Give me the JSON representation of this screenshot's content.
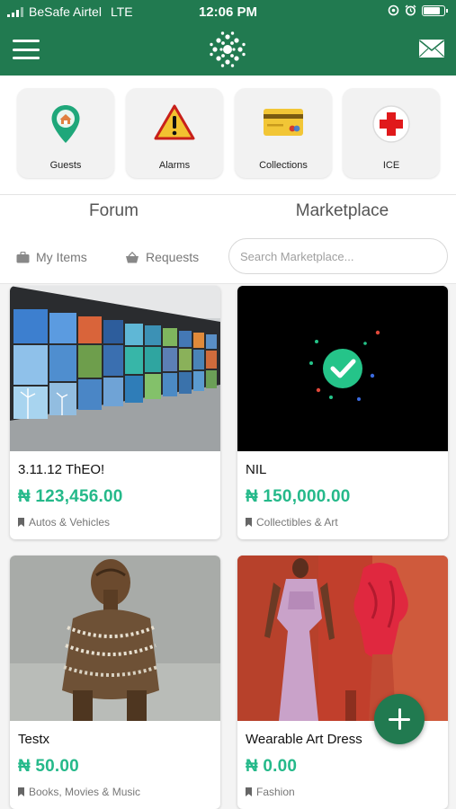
{
  "status_bar": {
    "carrier": "BeSafe Airtel",
    "network": "LTE",
    "time": "12:06 PM",
    "battery_level": 0.85
  },
  "header": {
    "menu_icon": "hamburger-icon",
    "logo_icon": "app-logo-icon",
    "mail_icon": "mail-icon",
    "brand_color": "#217a50"
  },
  "quick_tiles": [
    {
      "label": "Guests",
      "icon": "home-pin-icon"
    },
    {
      "label": "Alarms",
      "icon": "warning-icon"
    },
    {
      "label": "Collections",
      "icon": "card-icon"
    },
    {
      "label": "ICE",
      "icon": "medical-cross-icon"
    }
  ],
  "tabs": [
    {
      "label": "Forum",
      "active": false
    },
    {
      "label": "Marketplace",
      "active": true
    }
  ],
  "filters": {
    "my_items": "My Items",
    "requests": "Requests",
    "search_placeholder": "Search Marketplace..."
  },
  "listings": [
    {
      "title": "3.11.12 ThEO!",
      "price": "₦ 123,456.00",
      "category": "Autos & Vehicles",
      "image": "video-wall-photo"
    },
    {
      "title": "NIL",
      "price": "₦ 150,000.00",
      "category": "Collectibles & Art",
      "image": "checkmark-graphic"
    },
    {
      "title": "Testx",
      "price": "₦ 50.00",
      "category": "Books, Movies & Music",
      "image": "wooden-sculpture-photo"
    },
    {
      "title": "Wearable Art Dress",
      "price": "₦ 0.00",
      "category": "Fashion",
      "image": "dress-mannequins-photo"
    }
  ],
  "accent_price_color": "#25b98a",
  "fab_icon": "add-icon"
}
